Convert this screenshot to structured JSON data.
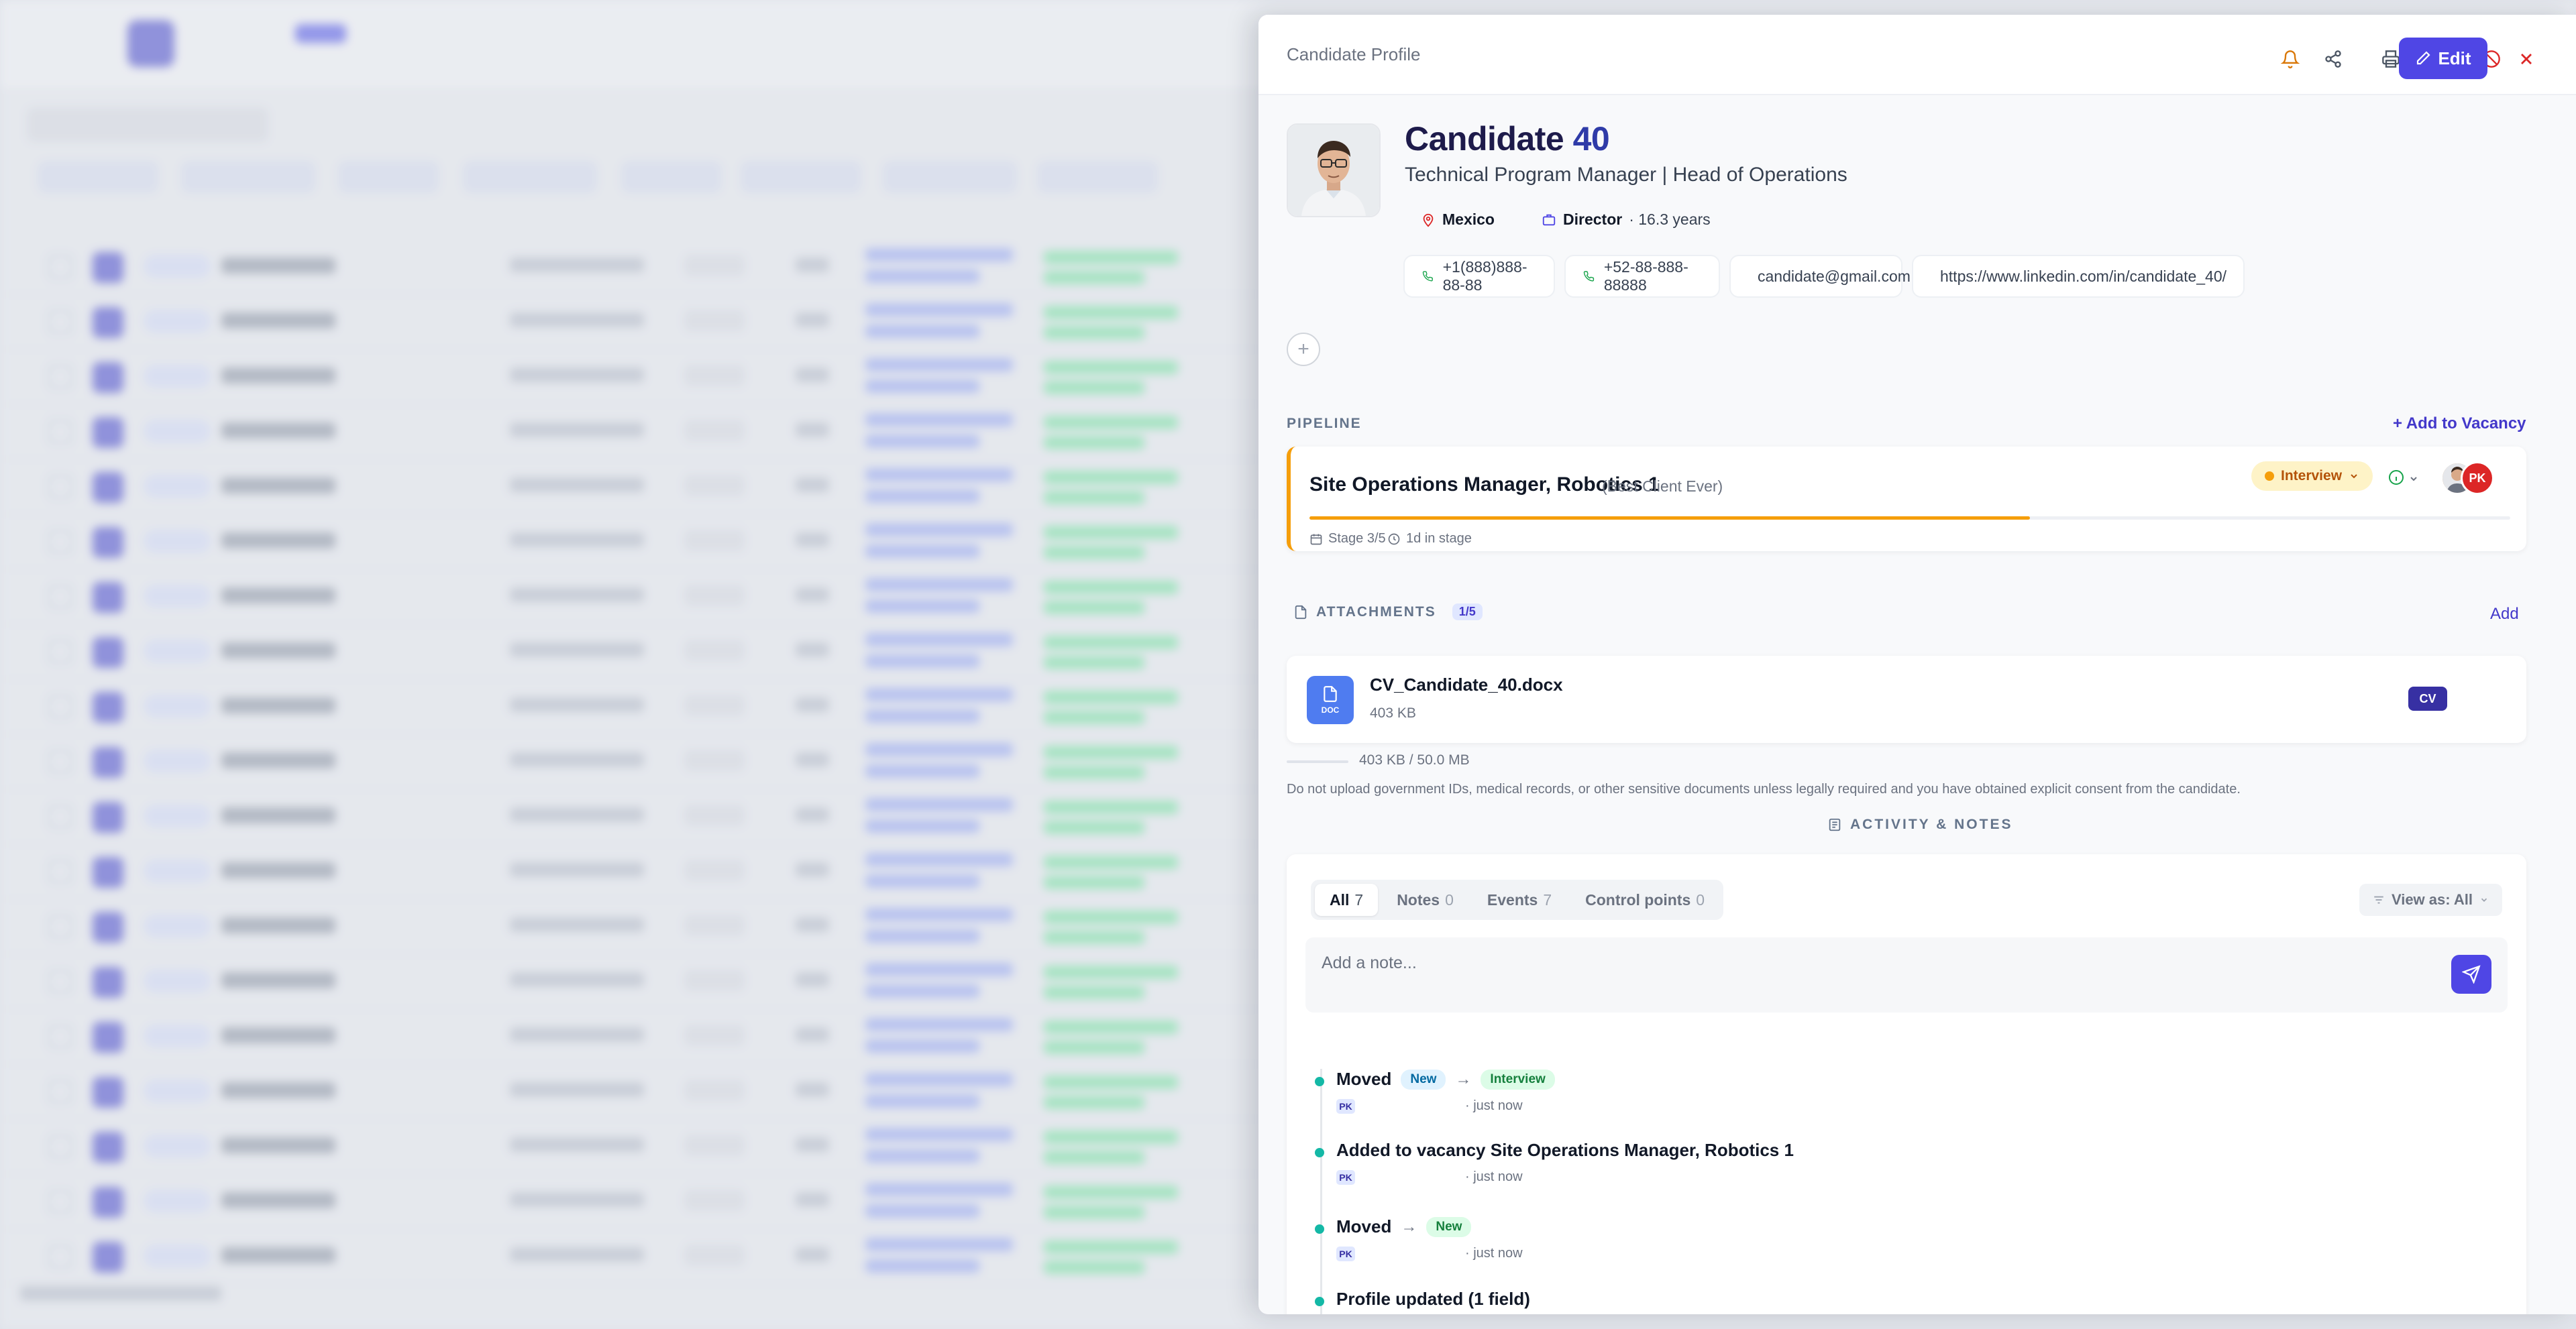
{
  "panel": {
    "header_title": "Candidate Profile",
    "edit_label": "Edit",
    "icons": [
      "bell-icon",
      "share-icon",
      "print-icon",
      "download-icon",
      "block-icon",
      "close-icon"
    ]
  },
  "candidate": {
    "name_prefix": "Candidate",
    "name_number": "40",
    "title": "Technical Program Manager | Head of Operations",
    "location": "Mexico",
    "seniority": "Director",
    "experience": "· 16.3 years",
    "contacts": {
      "phone1": "+1(888)888-88-88",
      "phone2": "+52-88-888-88888",
      "email": "candidate@gmail.com",
      "linkedin": "https://www.linkedin.com/in/candidate_40/"
    }
  },
  "pipeline": {
    "label": "PIPELINE",
    "add_link": "+ Add to Vacancy",
    "vacancy": "Site Operations Manager, Robotics 1",
    "client": "(Best Client Ever)",
    "stage": "Interview",
    "stage_progress": "Stage 3/5",
    "progress_fraction": 0.6,
    "time_in_stage": "1d in stage",
    "assignee_initials": "PK",
    "accent_color": "#f59e0b"
  },
  "attachments": {
    "label": "ATTACHMENTS",
    "count": "1/5",
    "add_link": "Add",
    "file_name": "CV_Candidate_40.docx",
    "file_size": "403 KB",
    "file_type": "DOC",
    "badge": "CV",
    "quota": "403 KB / 50.0 MB",
    "disclaimer": "Do not upload government IDs, medical records, or other sensitive documents unless legally required and you have obtained explicit consent from the candidate."
  },
  "activity": {
    "label": "ACTIVITY & NOTES",
    "tabs": [
      {
        "label": "All",
        "count": "7"
      },
      {
        "label": "Notes",
        "count": "0"
      },
      {
        "label": "Events",
        "count": "7"
      },
      {
        "label": "Control points",
        "count": "0"
      }
    ],
    "view_as": "View as: All",
    "note_placeholder": "Add a note...",
    "items": [
      {
        "title": "Moved",
        "from": "New",
        "to": "Interview",
        "author": "PK",
        "time": "· just now"
      },
      {
        "title": "Added to vacancy Site Operations Manager, Robotics 1",
        "author": "PK",
        "time": "· just now"
      },
      {
        "title": "Moved",
        "to": "New",
        "author": "PK",
        "time": "· just now"
      },
      {
        "title": "Profile updated (1 field)"
      }
    ]
  },
  "colors": {
    "accent": "#4f46e5",
    "timeline_dot": "#14b8a6",
    "danger": "#dc2626"
  }
}
